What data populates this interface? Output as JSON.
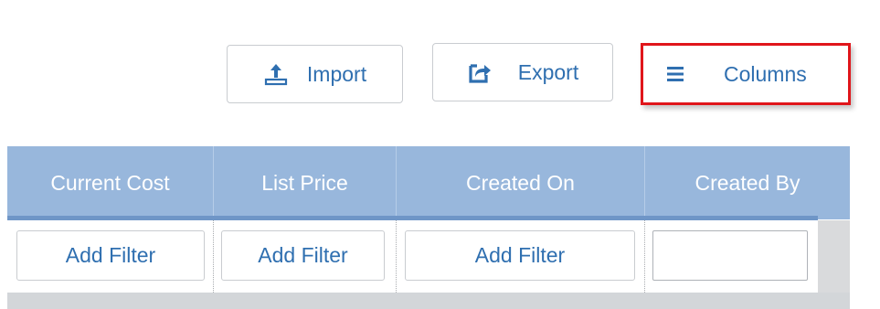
{
  "toolbar": {
    "import": {
      "label": "Import",
      "icon": "upload-tray-icon"
    },
    "export": {
      "label": "Export",
      "icon": "share-export-icon"
    },
    "columns": {
      "label": "Columns",
      "icon": "hamburger-menu-icon",
      "highlighted": true,
      "highlight_color": "#e0161b"
    }
  },
  "grid": {
    "header_color": "#98b7dc",
    "columns": [
      {
        "label": "Current Cost",
        "filter": "Add Filter"
      },
      {
        "label": "List Price",
        "filter": "Add Filter"
      },
      {
        "label": "Created On",
        "filter": "Add Filter"
      },
      {
        "label": "Created By",
        "filter_value": ""
      }
    ]
  },
  "colors": {
    "accent_text": "#2f6fb0",
    "header_text": "#ffffff"
  }
}
